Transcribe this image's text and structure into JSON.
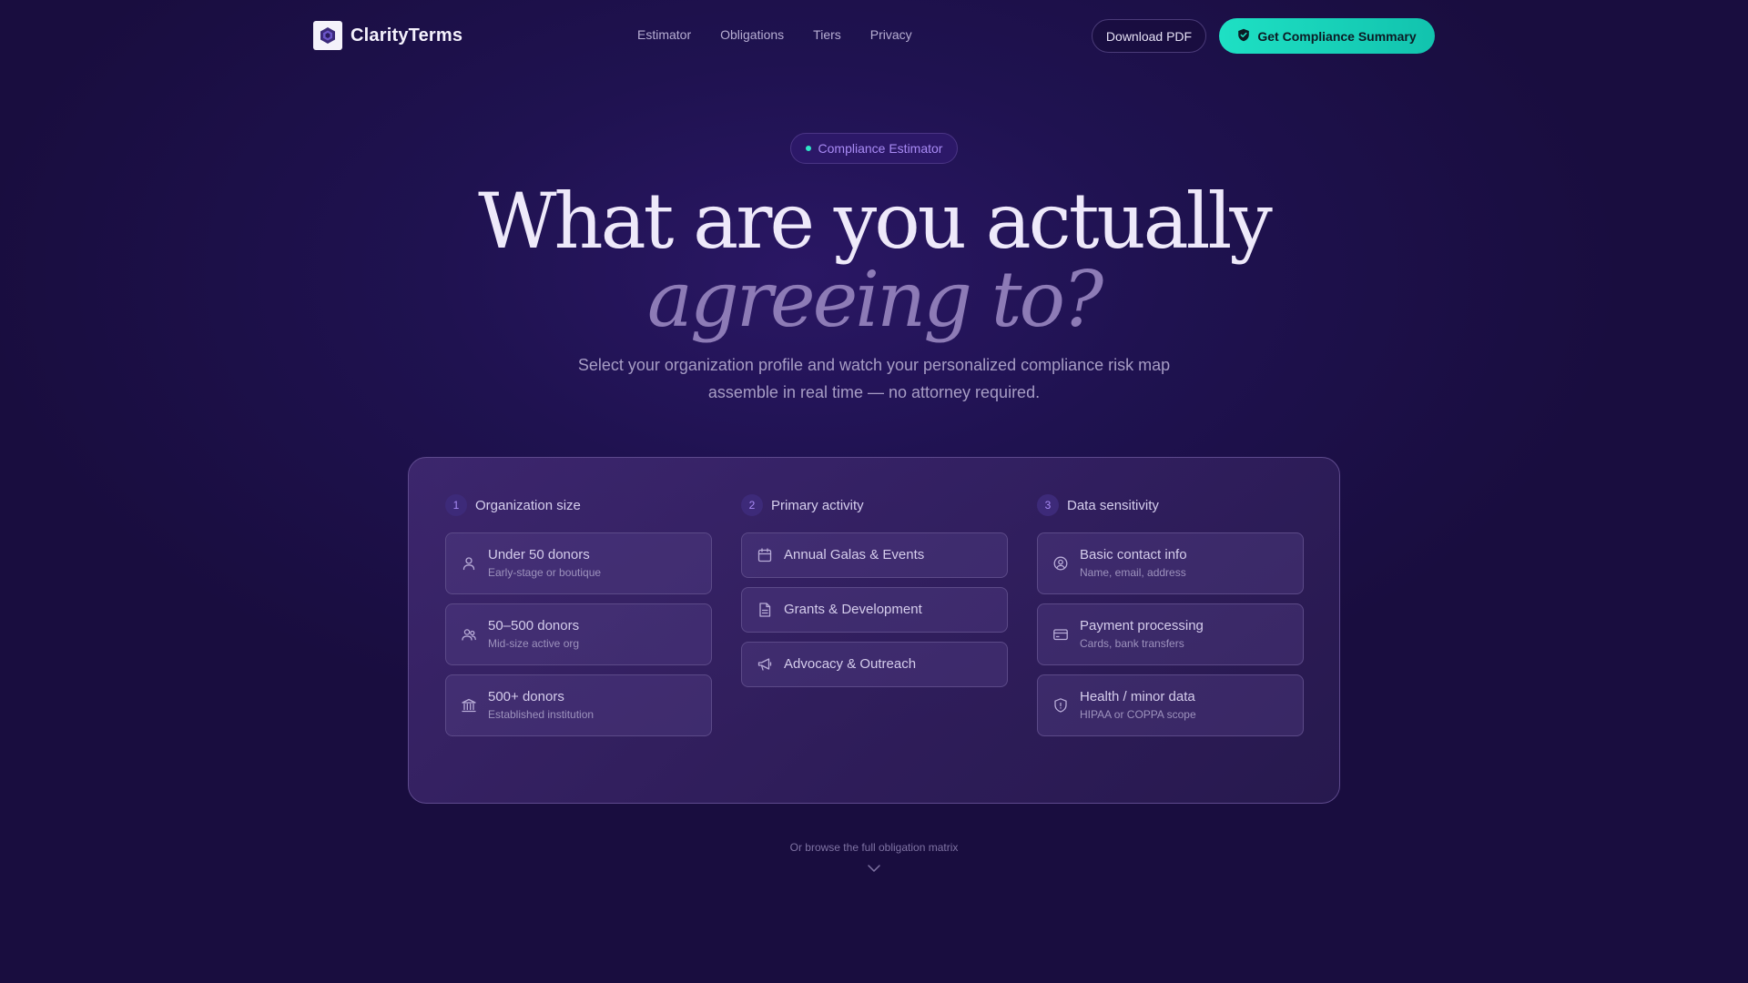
{
  "brand": {
    "name": "ClarityTerms",
    "logo_icon": "hexagon-shield-icon"
  },
  "nav": {
    "links": [
      "Estimator",
      "Obligations",
      "Tiers",
      "Privacy"
    ]
  },
  "actions": {
    "download_label": "Download PDF",
    "primary_label": "Get Compliance Summary",
    "primary_icon": "shield-check-icon"
  },
  "hero": {
    "badge": "Compliance Estimator",
    "headline_line1": "What are you actually",
    "headline_line2": "agreeing to?",
    "subtitle": "Select your organization profile and watch your personalized compliance risk map assemble in real time — no attorney required."
  },
  "estimator": {
    "columns": [
      {
        "step": "1",
        "title": "Organization size",
        "options": [
          {
            "icon": "person-icon",
            "title": "Under 50 donors",
            "sub": "Early-stage or boutique"
          },
          {
            "icon": "people-icon",
            "title": "50–500 donors",
            "sub": "Mid-size active org"
          },
          {
            "icon": "institution-icon",
            "title": "500+ donors",
            "sub": "Established institution"
          }
        ]
      },
      {
        "step": "2",
        "title": "Primary activity",
        "options": [
          {
            "icon": "calendar-icon",
            "title": "Annual Galas & Events"
          },
          {
            "icon": "document-icon",
            "title": "Grants & Development"
          },
          {
            "icon": "megaphone-icon",
            "title": "Advocacy & Outreach"
          }
        ]
      },
      {
        "step": "3",
        "title": "Data sensitivity",
        "options": [
          {
            "icon": "user-circle-icon",
            "title": "Basic contact info",
            "sub": "Name, email, address"
          },
          {
            "icon": "credit-card-icon",
            "title": "Payment processing",
            "sub": "Cards, bank transfers"
          },
          {
            "icon": "shield-icon",
            "title": "Health / minor data",
            "sub": "HIPAA or COPPA scope"
          }
        ]
      }
    ]
  },
  "footer": {
    "browse_text": "Or browse the full obligation matrix",
    "chevron_icon": "chevron-down-icon"
  },
  "colors": {
    "background": "#1f1250",
    "accent_teal": "#1ee0c4",
    "accent_purple": "#a98bf5"
  }
}
